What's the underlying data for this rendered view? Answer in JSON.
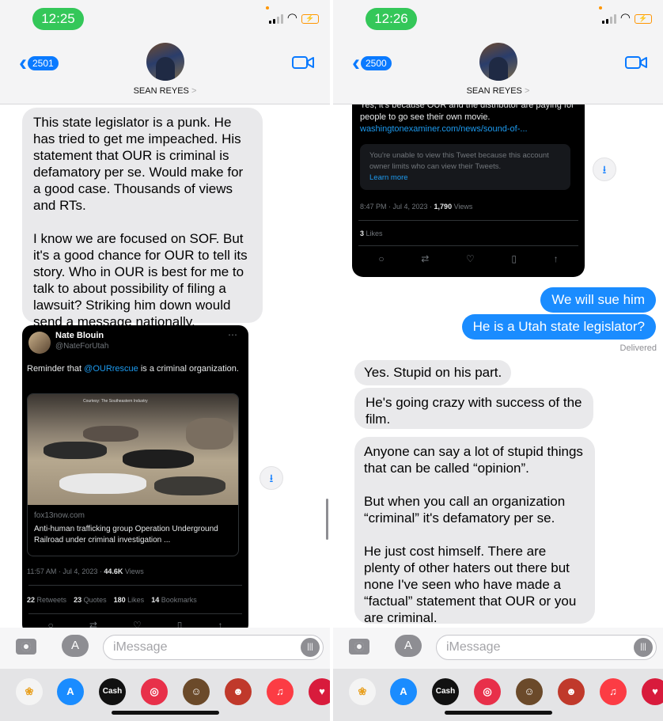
{
  "left": {
    "status": {
      "time": "12:25"
    },
    "header": {
      "back_count": "2501",
      "contact_name": "SEAN REYES",
      "chevron": ">"
    },
    "messages": [
      {
        "paragraphs": [
          "This state legislator is a punk. He has tried to get me impeached. His statement that OUR is criminal is defamatory per se. Would make for a good case. Thousands of views and RTs.",
          "I know we are focused on SOF. But it's a good chance for OUR to tell its story. Who in OUR is best for me to talk to about possibility of filing a lawsuit? Striking him down would send a message nationally."
        ]
      }
    ],
    "tweet": {
      "name": "Nate Blouin",
      "handle": "@NateForUtah",
      "text_before": "Reminder that ",
      "mention": "@OURrescue",
      "text_after": " is a criminal organization.",
      "card_domain": "fox13now.com",
      "card_title": "Anti-human trafficking group Operation Underground Railroad under criminal investigation ...",
      "photo_caption": "Courtesy: The Southeastern Industry",
      "time": "11:57 AM · Jul 4, 2023 · ",
      "views_count": "44.6K",
      "views_label": " Views",
      "stats": [
        {
          "count": "22",
          "label": "Retweets"
        },
        {
          "count": "23",
          "label": "Quotes"
        },
        {
          "count": "180",
          "label": "Likes"
        },
        {
          "count": "14",
          "label": "Bookmarks"
        }
      ]
    },
    "composer": {
      "placeholder": "iMessage"
    }
  },
  "right": {
    "status": {
      "time": "12:26"
    },
    "header": {
      "back_count": "2500",
      "contact_name": "SEAN REYES",
      "chevron": ">"
    },
    "tweet": {
      "text": "Yes, it's because OUR and the distributor are paying for people to go see their own movie.",
      "link": "washingtonexaminer.com/news/sound-of-...",
      "notice": "You're unable to view this Tweet because this account owner limits who can view their Tweets.",
      "learn_more": "Learn more",
      "time": "8:47 PM · Jul 4, 2023 · ",
      "views_count": "1,790",
      "views_label": " Views",
      "likes_count": "3",
      "likes_label": " Likes"
    },
    "messages_out": [
      "We will sue him",
      "He is a Utah state legislator?"
    ],
    "delivered": "Delivered",
    "messages_in": [
      {
        "paragraphs": [
          "Yes. Stupid on his part."
        ]
      },
      {
        "paragraphs": [
          "He's going crazy with success of the film."
        ]
      },
      {
        "paragraphs": [
          "Anyone can say a lot of stupid things that can be called “opinion”.",
          "But when you call an organization “criminal” it's defamatory per se.",
          "He just cost himself. There are plenty of other haters out there but none I've seen who have made a “factual” statement that OUR or you are criminal."
        ]
      }
    ],
    "composer": {
      "placeholder": "iMessage"
    }
  },
  "dock_apps": [
    {
      "name": "photos",
      "label": "❀",
      "color": "#f4f4f4"
    },
    {
      "name": "app-store",
      "label": "A",
      "color": "#1a8cff"
    },
    {
      "name": "cash",
      "label": "Cash",
      "color": "#111111"
    },
    {
      "name": "search-app",
      "label": "◎",
      "color": "#e8304a"
    },
    {
      "name": "memoji-1",
      "label": "☺",
      "color": "#6b4a2a"
    },
    {
      "name": "memoji-2",
      "label": "☻",
      "color": "#c0392b"
    },
    {
      "name": "music",
      "label": "♫",
      "color": "#fc3c44"
    },
    {
      "name": "heart-app",
      "label": "♥",
      "color": "#d81b3c"
    }
  ],
  "colors": {
    "imessage_blue": "#1a8cff",
    "incoming_gray": "#e9e9eb",
    "status_green": "#34c759",
    "tweet_bg": "#000000"
  }
}
